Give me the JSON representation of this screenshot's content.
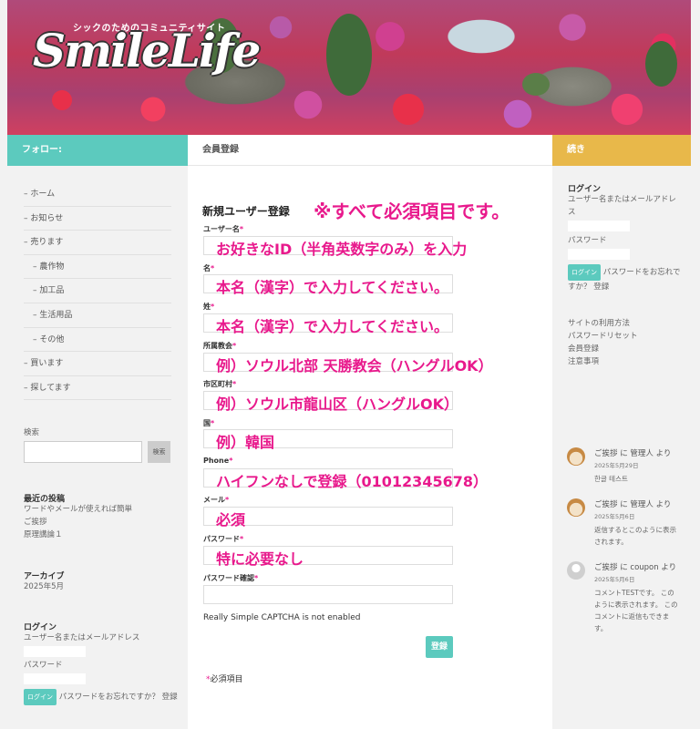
{
  "site": {
    "logo_small": "シックのためのコミュニティサイト",
    "logo_big": "SmileLife"
  },
  "left": {
    "header": "フォロー:",
    "nav": [
      {
        "label": "ホーム"
      },
      {
        "label": "お知らせ"
      },
      {
        "label": "売ります"
      },
      {
        "label": "農作物"
      },
      {
        "label": "加工品"
      },
      {
        "label": "生活用品"
      },
      {
        "label": "その他"
      },
      {
        "label": "買います"
      },
      {
        "label": "探してます"
      }
    ],
    "search_title": "検索",
    "search_button": "検索",
    "recent_title": "最近の投稿",
    "recent": [
      "ワードやメールが使えれば簡単",
      "ご挨拶",
      "原理講論１"
    ],
    "archive_title": "アーカイブ",
    "archive_item": "2025年5月",
    "login_title": "ログイン",
    "login_user_label": "ユーザー名またはメールアドレス",
    "login_pass_label": "パスワード",
    "login_button": "ログイン",
    "login_forgot": "パスワードをお忘れですか？ 登録"
  },
  "center": {
    "header": "会員登録",
    "form_title": "新規ユーザー登録",
    "notice": "※すべて必須項目です。",
    "fields": [
      {
        "label": "ユーザー名",
        "hint": "お好きなID（半角英数字のみ）を入力"
      },
      {
        "label": "名",
        "hint": "本名（漢字）で入力してください。"
      },
      {
        "label": "姓",
        "hint": "本名（漢字）で入力してください。"
      },
      {
        "label": "所属教会",
        "hint": "例）ソウル北部 天勝教会（ハングルOK）"
      },
      {
        "label": "市区町村",
        "hint": "例）ソウル市龍山区（ハングルOK）"
      },
      {
        "label": "国",
        "hint": "例）韓国"
      },
      {
        "label": "Phone",
        "hint": "ハイフンなしで登録（01012345678）"
      },
      {
        "label": "メール",
        "hint": "必須"
      },
      {
        "label": "パスワード",
        "hint": "特に必要なし"
      },
      {
        "label": "パスワード確認",
        "hint": ""
      }
    ],
    "required_mark": "*",
    "captcha": "Really Simple CAPTCHA is not enabled",
    "submit": "登録",
    "required_note": "必須項目"
  },
  "right": {
    "header": "続き",
    "login_title": "ログイン",
    "login_user_label": "ユーザー名またはメールアドレス",
    "login_pass_label": "パスワード",
    "login_button": "ログイン",
    "login_forgot": "パスワードをお忘れですか？ 登録",
    "links": [
      "サイトの利用方法",
      "パスワードリセット",
      "会員登録",
      "注意事項"
    ],
    "comments": [
      {
        "meta": "ご挨拶 に 管理人 より",
        "date": "2025年5月29日",
        "text": "한글 테스트"
      },
      {
        "meta": "ご挨拶 に 管理人 より",
        "date": "2025年5月6日",
        "text": "返信するとこのように表示されます。"
      },
      {
        "meta": "ご挨拶 に coupon より",
        "date": "2025年5月6日",
        "text": "コメントTESTです。 このように表示されます。 このコメントに返信もできます。"
      }
    ]
  }
}
